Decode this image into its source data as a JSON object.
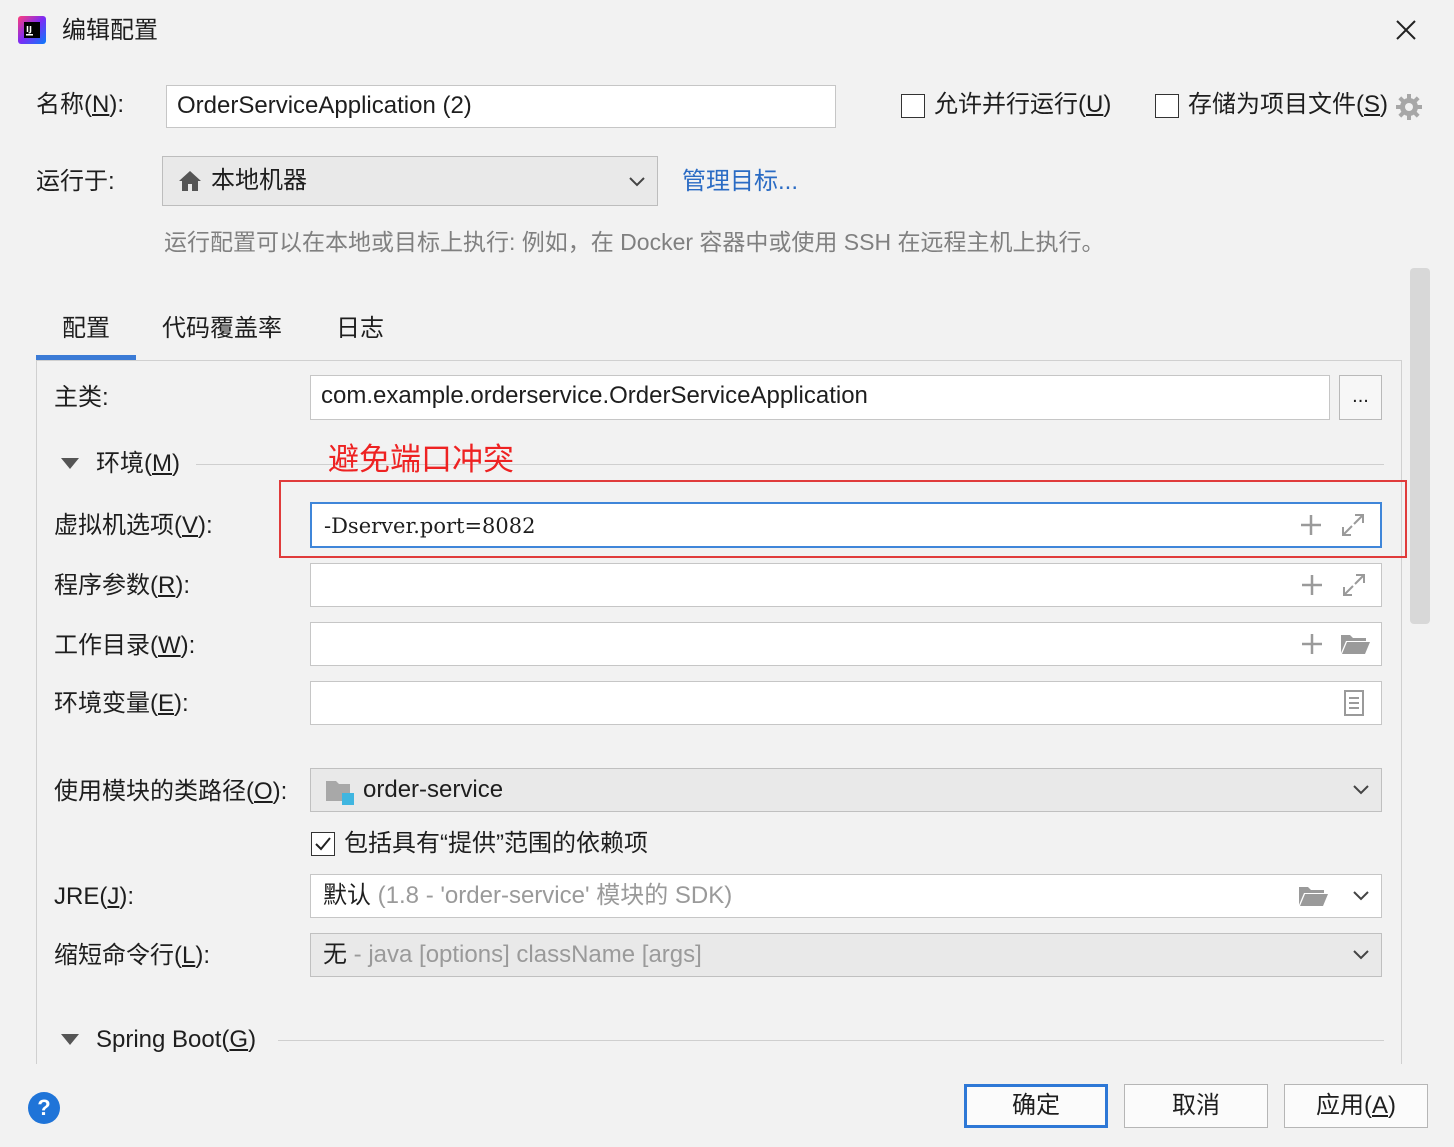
{
  "window": {
    "title": "编辑配置"
  },
  "name": {
    "label": "名称(N):",
    "label_pre": "名称(",
    "mnemonic": "N",
    "label_post": "):",
    "value": "OrderServiceApplication (2)"
  },
  "options": {
    "parallel": {
      "label_pre": "允许并行运行(",
      "mnemonic": "U",
      "label_post": ")",
      "checked": false
    },
    "store": {
      "label_pre": "存储为项目文件(",
      "mnemonic": "S",
      "label_post": ")",
      "checked": false
    }
  },
  "run_on": {
    "label": "运行于:",
    "value": "本地机器",
    "manage_link": "管理目标...",
    "hint": "运行配置可以在本地或目标上执行: 例如，在 Docker 容器中或使用 SSH 在远程主机上执行。"
  },
  "tabs": [
    {
      "label": "配置",
      "active": true
    },
    {
      "label": "代码覆盖率",
      "active": false
    },
    {
      "label": "日志",
      "active": false
    }
  ],
  "config": {
    "main_class": {
      "label": "主类:",
      "value": "com.example.orderservice.OrderServiceApplication",
      "browse": "..."
    },
    "environment": {
      "label_pre": "环境(",
      "mnemonic": "M",
      "label_post": ")"
    },
    "annotation": "避免端口冲突",
    "vm_options": {
      "label_pre": "虚拟机选项(",
      "mnemonic": "V",
      "label_post": "):",
      "value": "-Dserver.port=8082"
    },
    "program_args": {
      "label_pre": "程序参数(",
      "mnemonic": "R",
      "label_post": "):",
      "value": ""
    },
    "working_dir": {
      "label_pre": "工作目录(",
      "mnemonic": "W",
      "label_post": "):",
      "value": ""
    },
    "env_vars": {
      "label_pre": "环境变量(",
      "mnemonic": "E",
      "label_post": "):",
      "value": ""
    },
    "module_classpath": {
      "label_pre": "使用模块的类路径(",
      "mnemonic": "O",
      "label_post": "):",
      "value": "order-service"
    },
    "include_provided": {
      "label": "包括具有“提供”范围的依赖项",
      "checked": true
    },
    "jre": {
      "label_pre": "JRE(",
      "mnemonic": "J",
      "label_post": "):",
      "value": "默认",
      "detail": " (1.8 - 'order-service' 模块的 SDK)"
    },
    "shorten": {
      "label_pre": "缩短命令行(",
      "mnemonic": "L",
      "label_post": "):",
      "value": "无",
      "detail": " - java [options] className [args]"
    },
    "spring_boot": {
      "label_pre": "Spring Boot(",
      "mnemonic": "G",
      "label_post": ")"
    }
  },
  "footer": {
    "help": "?",
    "ok": "确定",
    "cancel": "取消",
    "apply_pre": "应用(",
    "apply_mnemonic": "A",
    "apply_post": ")"
  },
  "colors": {
    "accent": "#3b7bd6",
    "link": "#2a6bc4",
    "annotation": "#ee2222",
    "focus_border": "#3f86d9"
  },
  "icons": [
    "intellij-logo-icon",
    "close-icon",
    "gear-icon",
    "home-icon",
    "chevron-down-icon",
    "plus-icon",
    "expand-icon",
    "folder-icon",
    "document-icon",
    "module-icon",
    "help-icon",
    "triangle-down-icon"
  ]
}
